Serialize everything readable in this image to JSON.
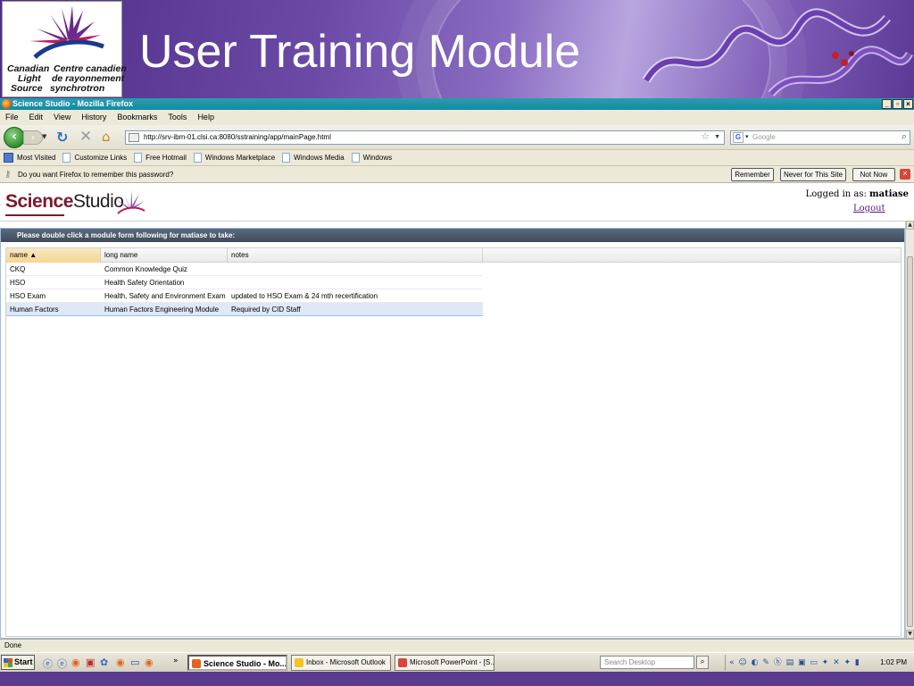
{
  "slide": {
    "title": "User Training Module",
    "logo_lines": [
      "Canadian",
      "Light",
      "Source",
      "Centre canadien",
      "de rayonnement",
      "synchrotron"
    ]
  },
  "window": {
    "title": "Science Studio - Mozilla Firefox",
    "buttons": [
      "_",
      "̅",
      "x"
    ]
  },
  "menu": [
    "File",
    "Edit",
    "View",
    "History",
    "Bookmarks",
    "Tools",
    "Help"
  ],
  "nav": {
    "url": "http://srv-ibm-01.clsi.ca:8080/sstraining/app/mainPage.html",
    "search_placeholder": "Google"
  },
  "bookmarks": [
    "Most Visited",
    "Customize Links",
    "Free Hotmail",
    "Windows Marketplace",
    "Windows Media",
    "Windows"
  ],
  "notification": {
    "message": "Do you want Firefox to remember this password?",
    "remember": "Remember",
    "never": "Never for This Site",
    "not_now": "Not Now"
  },
  "app": {
    "logo_science": "Science",
    "logo_studio": "Studio",
    "logged_in_label": "Logged in as:",
    "logged_in_user": "matiase",
    "logout": "Logout"
  },
  "panel": {
    "header": "Please double click a module form following for matiase to take:",
    "columns": [
      "name ▲",
      "long name",
      "notes"
    ],
    "rows": [
      {
        "name": "CKQ",
        "long_name": "Common Knowledge Quiz",
        "notes": ""
      },
      {
        "name": "HSO",
        "long_name": "Health Safety Orientation",
        "notes": ""
      },
      {
        "name": "HSO Exam",
        "long_name": "Health, Safety and Environment Exam",
        "notes": "updated to HSO Exam & 24 mth recertification"
      },
      {
        "name": "Human Factors",
        "long_name": "Human Factors Engineering Module",
        "notes": "Required by CID Staff"
      }
    ]
  },
  "status": "Done",
  "taskbar": {
    "start": "Start",
    "tasks": [
      "Science Studio - Mo...",
      "Inbox - Microsoft Outlook",
      "Microsoft PowerPoint - [S..."
    ],
    "search_placeholder": "Search Desktop",
    "clock": "1:02 PM"
  },
  "colors": {
    "slide_purple": "#5a3b8e",
    "titlebar": "#148aa0",
    "panel_header": "#3e4b5b",
    "selected_row": "#dfe8f6",
    "logo_red": "#7b1a2e"
  }
}
